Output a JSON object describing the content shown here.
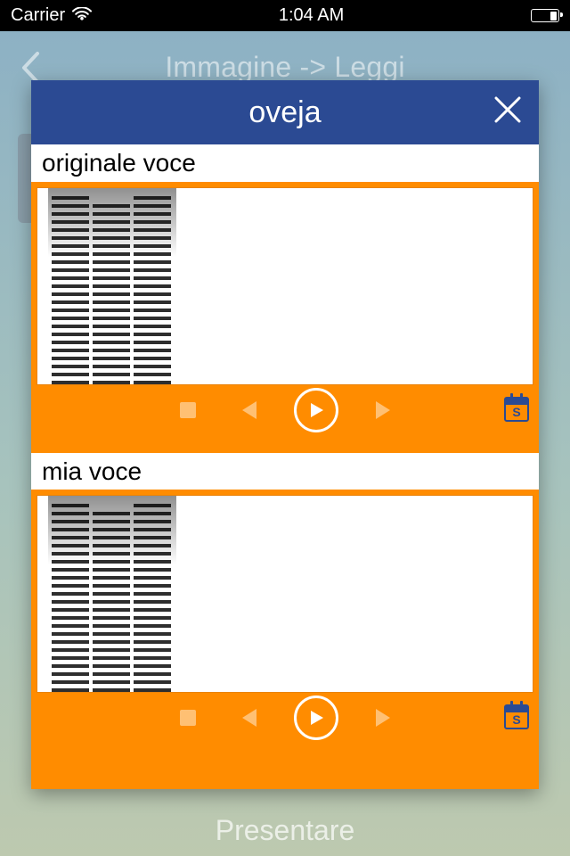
{
  "status": {
    "carrier": "Carrier",
    "time": "1:04 AM"
  },
  "nav": {
    "title": "Immagine -> Leggi"
  },
  "footer": {
    "present_label": "Presentare"
  },
  "modal": {
    "title": "oveja",
    "panel1_label": "originale voce",
    "panel2_label": "mia voce",
    "calendar_glyph": "S"
  }
}
